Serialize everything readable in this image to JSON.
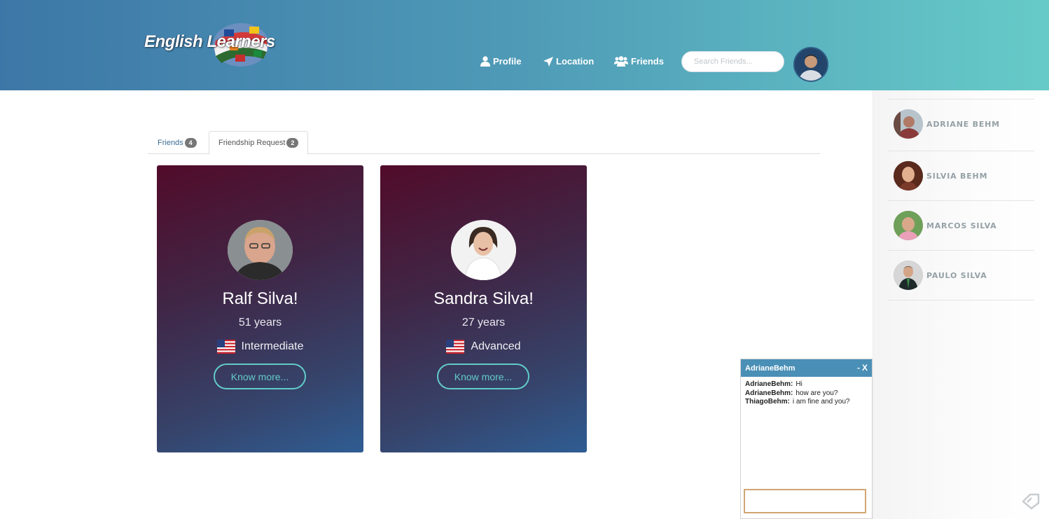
{
  "header": {
    "logo_text": "English Learners",
    "nav": [
      {
        "label": "Profile",
        "icon": "user-icon"
      },
      {
        "label": "Location",
        "icon": "location-arrow-icon"
      },
      {
        "label": "Friends",
        "icon": "users-icon"
      }
    ],
    "search_placeholder": "Search Friends..."
  },
  "tabs": [
    {
      "label": "Friends",
      "badge": "4"
    },
    {
      "label": "Friendship Request",
      "badge": "2",
      "active": true
    }
  ],
  "cards": [
    {
      "name": "Ralf Silva!",
      "age": "51 years",
      "level": "Intermediate",
      "flag": "us-flag-icon",
      "button": "Know more..."
    },
    {
      "name": "Sandra Silva!",
      "age": "27 years",
      "level": "Advanced",
      "flag": "us-flag-icon",
      "button": "Know more..."
    }
  ],
  "sidebar": {
    "contacts": [
      {
        "name": "ADRIANE BEHM"
      },
      {
        "name": "SILVIA BEHM"
      },
      {
        "name": "MARCOS SILVA"
      },
      {
        "name": "PAULO SILVA"
      }
    ]
  },
  "chat": {
    "title": "AdrianeBehm",
    "minimize": "-",
    "close": "X",
    "messages": [
      {
        "from": "AdrianeBehm:",
        "text": "Hi"
      },
      {
        "from": "AdrianeBehm:",
        "text": "how are you?"
      },
      {
        "from": "ThiagoBehm:",
        "text": "i am fine and you?"
      }
    ]
  },
  "colors": {
    "header_gradient": [
      "#3d77a7",
      "#66cbc8"
    ],
    "card_gradient": [
      "#520b2a",
      "#2f5d93"
    ],
    "accent": "#62cbc8",
    "chat_header": "#4a8fb5"
  }
}
